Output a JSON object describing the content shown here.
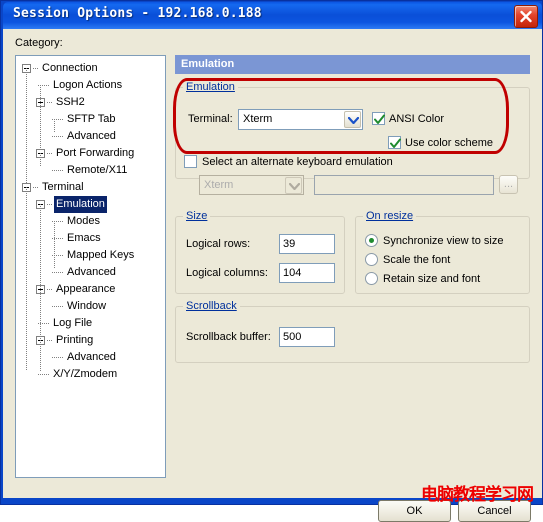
{
  "window": {
    "title": "Session Options - 192.168.0.188",
    "close_icon": "close-icon"
  },
  "category": {
    "label": "Category:",
    "tree": [
      {
        "label": "Connection",
        "indent": 0,
        "expander": true,
        "selected": false
      },
      {
        "label": "Logon Actions",
        "indent": 1,
        "expander": false,
        "selected": false
      },
      {
        "label": "SSH2",
        "indent": 1,
        "expander": true,
        "selected": false
      },
      {
        "label": "SFTP Tab",
        "indent": 2,
        "expander": false,
        "selected": false
      },
      {
        "label": "Advanced",
        "indent": 2,
        "expander": false,
        "selected": false
      },
      {
        "label": "Port Forwarding",
        "indent": 1,
        "expander": true,
        "selected": false
      },
      {
        "label": "Remote/X11",
        "indent": 2,
        "expander": false,
        "selected": false
      },
      {
        "label": "Terminal",
        "indent": 0,
        "expander": true,
        "selected": false
      },
      {
        "label": "Emulation",
        "indent": 1,
        "expander": true,
        "selected": true
      },
      {
        "label": "Modes",
        "indent": 2,
        "expander": false,
        "selected": false
      },
      {
        "label": "Emacs",
        "indent": 2,
        "expander": false,
        "selected": false
      },
      {
        "label": "Mapped Keys",
        "indent": 2,
        "expander": false,
        "selected": false
      },
      {
        "label": "Advanced",
        "indent": 2,
        "expander": false,
        "selected": false
      },
      {
        "label": "Appearance",
        "indent": 1,
        "expander": true,
        "selected": false
      },
      {
        "label": "Window",
        "indent": 2,
        "expander": false,
        "selected": false
      },
      {
        "label": "Log File",
        "indent": 1,
        "expander": false,
        "selected": false
      },
      {
        "label": "Printing",
        "indent": 1,
        "expander": true,
        "selected": false
      },
      {
        "label": "Advanced",
        "indent": 2,
        "expander": false,
        "selected": false
      },
      {
        "label": "X/Y/Zmodem",
        "indent": 1,
        "expander": false,
        "selected": false
      }
    ]
  },
  "pane": {
    "header": "Emulation",
    "emulation_group": {
      "title": "Emulation",
      "terminal_label": "Terminal:",
      "terminal_value": "Xterm",
      "ansi_color_label": "ANSI Color",
      "ansi_color_checked": true,
      "use_color_scheme_label": "Use color scheme",
      "use_color_scheme_checked": true,
      "alt_keyboard_label": "Select an alternate keyboard emulation",
      "alt_keyboard_checked": false,
      "alt_keyboard_combo_value": "Xterm",
      "alt_keyboard_path_value": "",
      "browse_button_label": "..."
    },
    "size_group": {
      "title": "Size",
      "rows_label": "Logical rows:",
      "rows_value": "39",
      "columns_label": "Logical columns:",
      "columns_value": "104"
    },
    "resize_group": {
      "title": "On resize",
      "options": [
        {
          "label": "Synchronize view to size",
          "selected": true
        },
        {
          "label": "Scale the font",
          "selected": false
        },
        {
          "label": "Retain size and font",
          "selected": false
        }
      ]
    },
    "scrollback_group": {
      "title": "Scrollback",
      "buffer_label": "Scrollback buffer:",
      "buffer_value": "500"
    }
  },
  "footer": {
    "ok_label": "OK",
    "cancel_label": "Cancel"
  },
  "annotations": {
    "watermark_text": "电脑教程学习网",
    "highlight_color": "#c00000",
    "watermark_color": "#ee0000"
  }
}
